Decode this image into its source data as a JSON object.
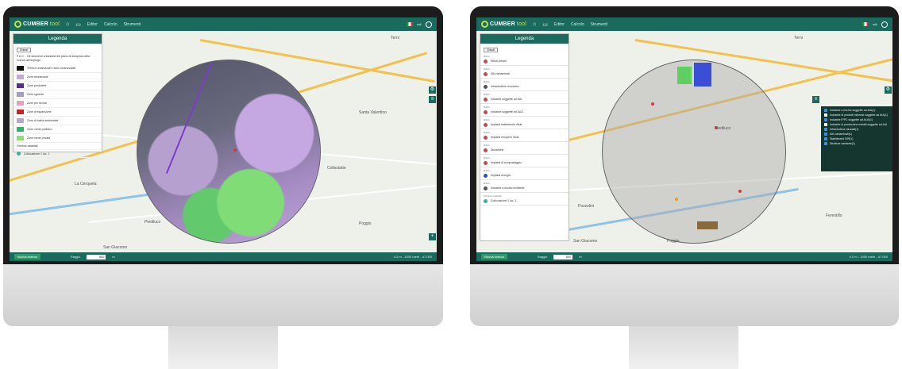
{
  "app": {
    "brand_name": "CUMBER",
    "brand_suffix": "tool",
    "menu": [
      "Editor",
      "Calcolo",
      "Strumenti"
    ]
  },
  "left_screen": {
    "legend": {
      "title": "Legenda",
      "close_label": "Chiudi",
      "intro": "P.U.C. - Gli strumenti urbanistici del piano di disciplina della ricerca dell'impiego",
      "items": [
        {
          "label": "Territori urbanizzati e aree urbanizzabili",
          "color": "#111111"
        },
        {
          "label": "Zone residenziali",
          "color": "#c6a8e0"
        },
        {
          "label": "Zone produttive",
          "color": "#5a2a93"
        },
        {
          "label": "Zone agricole",
          "color": "#a89ac2"
        },
        {
          "label": "Zone per servizi",
          "color": "#e3a0c0"
        },
        {
          "label": "Zone di espansione",
          "color": "#cc2222"
        },
        {
          "label": "Zone di tutela ambientale",
          "color": "#b7a8c8"
        },
        {
          "label": "Zone verde pubblico",
          "color": "#2fb66b"
        },
        {
          "label": "Zone verde privato",
          "color": "#8ee07a"
        }
      ],
      "footer_label": "Ortofoto catastali",
      "footer_sub": "Collocazione 1 loc. 1"
    },
    "towns": [
      "Terni",
      "La Cerqueta",
      "Piediluco",
      "Collestatte",
      "San Giacomo",
      "Poggio",
      "Santa Valentino"
    ],
    "bottombar": {
      "button": "Nuova ricerca",
      "raggio_label": "Raggio",
      "raggio_value": "500",
      "unit": "m",
      "status": "4.0 m - 1000 metri - 47.000"
    }
  },
  "right_screen": {
    "legend": {
      "title": "Legenda",
      "close_label": "Chiudi",
      "sections": [
        {
          "head": "Rifiuti",
          "label": "Rifiuti Urbani",
          "color": "#c94a4a"
        },
        {
          "head": "Rifiuti",
          "label": "Siti contaminati",
          "color": "#c94a4a"
        },
        {
          "head": "Rifiuti",
          "label": "Infrastrutture di scarico",
          "color": "#555555"
        },
        {
          "head": "Rifiuti",
          "label": "Industrie soggette ad AIA",
          "color": "#c94a4a"
        },
        {
          "head": "Rifiuti",
          "label": "Industrie soggette ad AUA",
          "color": "#c94a4a"
        },
        {
          "head": "Rifiuti",
          "label": "Impianti trattamento rifiuti",
          "color": "#c94a4a"
        },
        {
          "head": "Rifiuti",
          "label": "Impianti recupero rifiuti",
          "color": "#c94a4a"
        },
        {
          "head": "Rifiuti",
          "label": "Discariche",
          "color": "#c94a4a"
        },
        {
          "head": "Rifiuti",
          "label": "Impianti di compostaggio",
          "color": "#c94a4a"
        },
        {
          "head": "Rifiuti",
          "label": "Impianti energia",
          "color": "#2a4fc9"
        },
        {
          "head": "Rifiuti",
          "label": "Industrie a rischio incidente",
          "color": "#555555"
        }
      ],
      "footer_label": "Ortofoto catastali",
      "footer_sub": "Collocazione 1 loc. 1"
    },
    "layers": [
      {
        "label": "Industrie a rischio soggette ad AIA(1)",
        "checked": true
      },
      {
        "label": "Industrie di prodotti minerali soggette ad AIA(1)",
        "checked": false
      },
      {
        "label": "Industrie IPPC soggette ad AUA(1)",
        "checked": true
      },
      {
        "label": "Industrie di produzione metalli soggette ad AIA",
        "checked": false
      },
      {
        "label": "Infrastrutture stradali(1)",
        "checked": true
      },
      {
        "label": "Siti contaminati(1)",
        "checked": true
      },
      {
        "label": "Stabilimenti RIR(1)",
        "checked": true
      },
      {
        "label": "Strutture sanitarie(1)",
        "checked": true
      }
    ],
    "towns": [
      "Terni",
      "Piediluco",
      "Pozzolini",
      "San Giacomo",
      "Poggio",
      "Ferentillo"
    ],
    "bottombar": {
      "button": "Nuova ricerca",
      "raggio_label": "Raggio",
      "raggio_value": "500",
      "unit": "m",
      "status": "4.0 m - 1000 metri - 47.000"
    }
  }
}
